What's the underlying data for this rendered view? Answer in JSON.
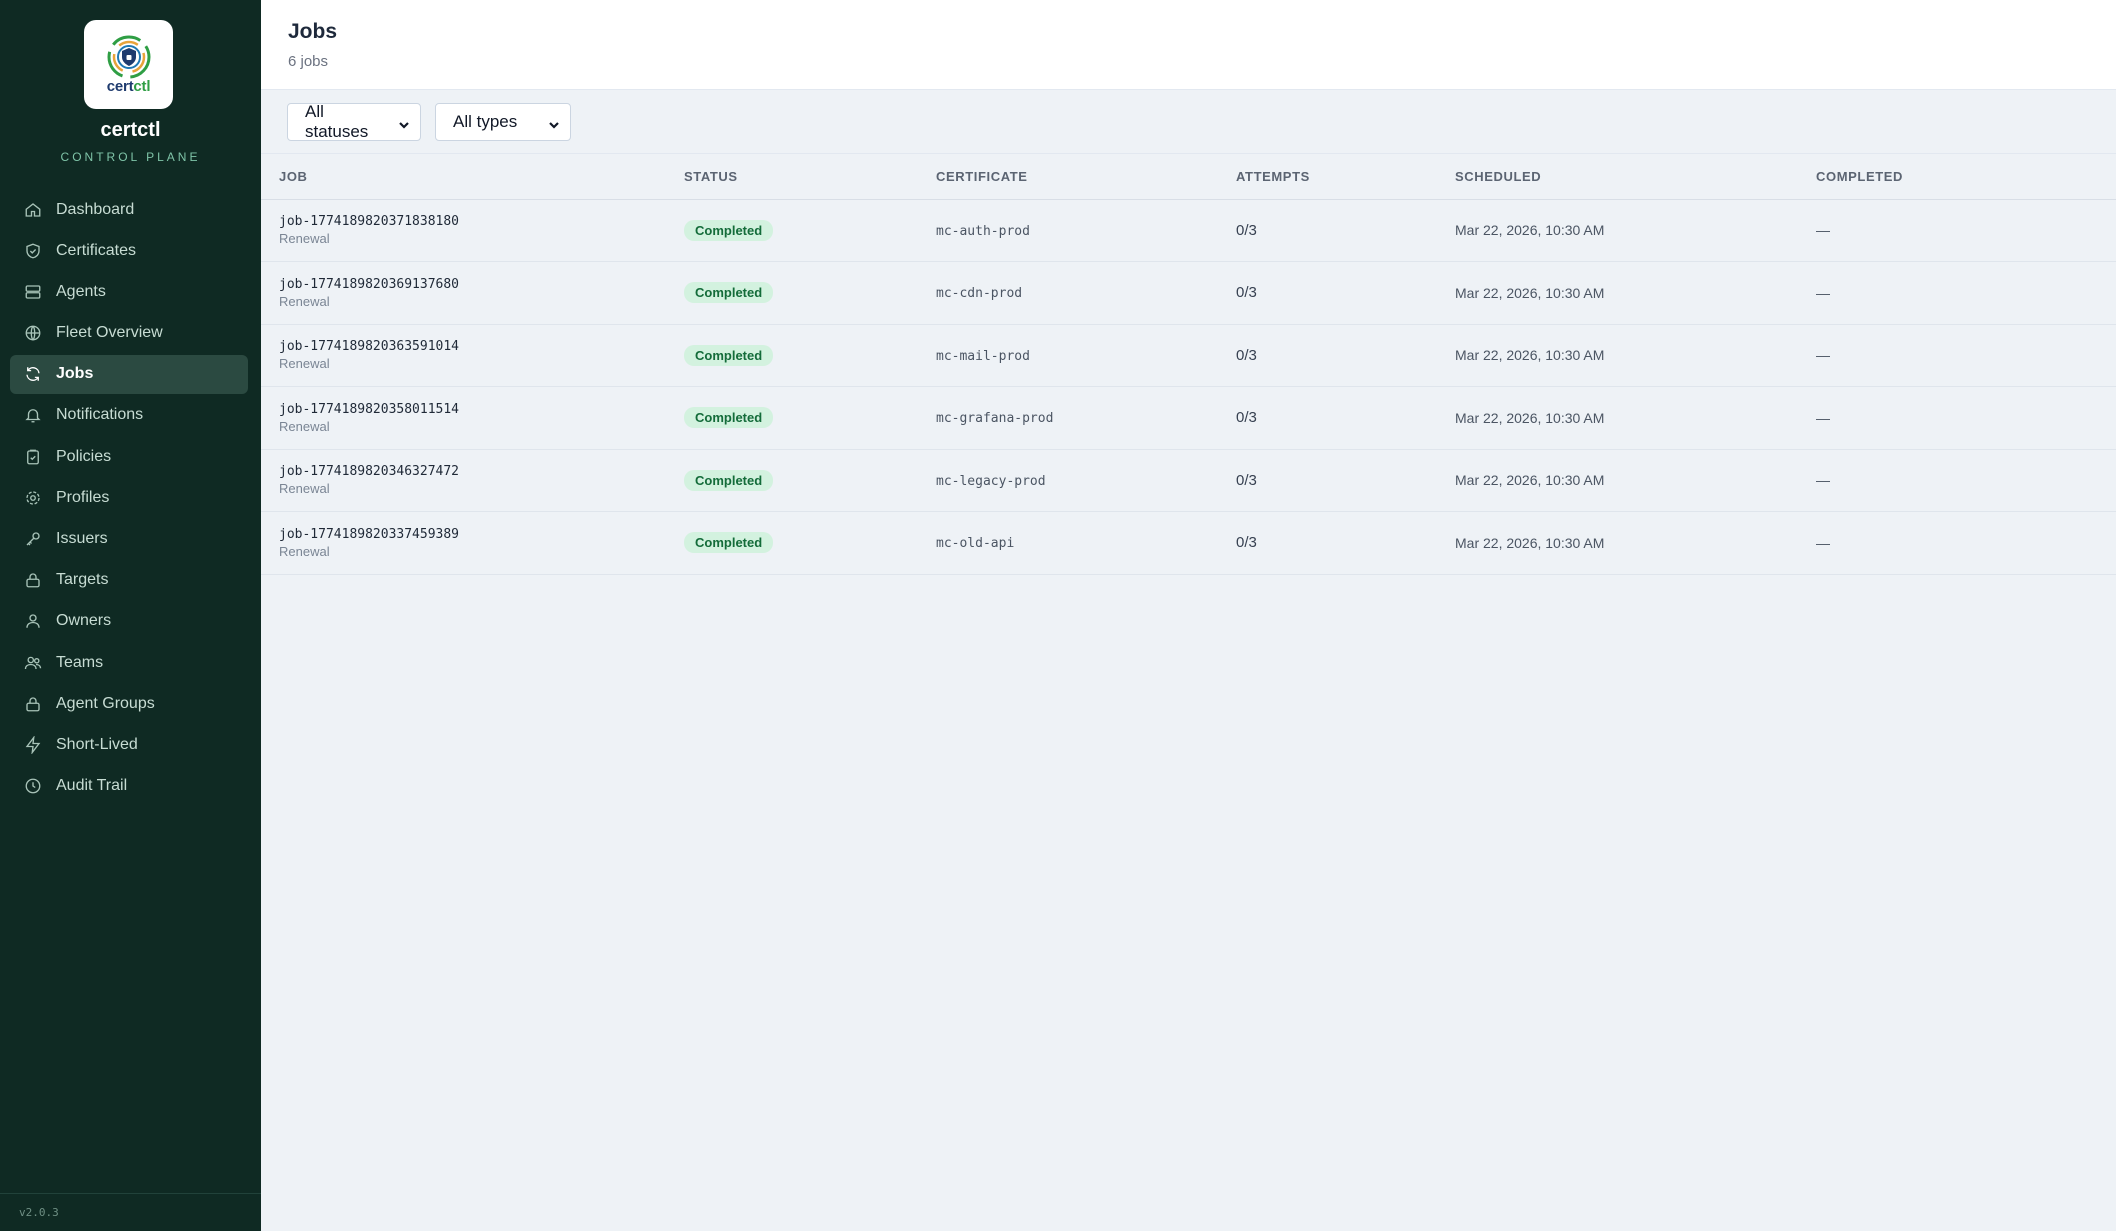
{
  "brand": {
    "logo_text_a": "cert",
    "logo_text_b": "ctl",
    "name": "certctl",
    "subtitle": "CONTROL PLANE",
    "version": "v2.0.3"
  },
  "sidebar": {
    "items": [
      {
        "label": "Dashboard",
        "icon": "home-icon",
        "active": false
      },
      {
        "label": "Certificates",
        "icon": "shield-check-icon",
        "active": false
      },
      {
        "label": "Agents",
        "icon": "server-icon",
        "active": false
      },
      {
        "label": "Fleet Overview",
        "icon": "globe-icon",
        "active": false
      },
      {
        "label": "Jobs",
        "icon": "refresh-icon",
        "active": true
      },
      {
        "label": "Notifications",
        "icon": "bell-icon",
        "active": false
      },
      {
        "label": "Policies",
        "icon": "clipboard-check-icon",
        "active": false
      },
      {
        "label": "Profiles",
        "icon": "gear-icon",
        "active": false
      },
      {
        "label": "Issuers",
        "icon": "key-icon",
        "active": false
      },
      {
        "label": "Targets",
        "icon": "lock-icon",
        "active": false
      },
      {
        "label": "Owners",
        "icon": "user-icon",
        "active": false
      },
      {
        "label": "Teams",
        "icon": "users-icon",
        "active": false
      },
      {
        "label": "Agent Groups",
        "icon": "lock-group-icon",
        "active": false
      },
      {
        "label": "Short-Lived",
        "icon": "lightning-icon",
        "active": false
      },
      {
        "label": "Audit Trail",
        "icon": "clock-icon",
        "active": false
      }
    ]
  },
  "header": {
    "title": "Jobs",
    "count": "6 jobs"
  },
  "filters": {
    "status": "All statuses",
    "type": "All types"
  },
  "table": {
    "columns": [
      "JOB",
      "STATUS",
      "CERTIFICATE",
      "ATTEMPTS",
      "SCHEDULED",
      "COMPLETED"
    ],
    "rows": [
      {
        "id": "job-1774189820371838180",
        "type": "Renewal",
        "status": "Completed",
        "certificate": "mc-auth-prod",
        "attempts": "0/3",
        "scheduled": "Mar 22, 2026, 10:30 AM",
        "completed": "—"
      },
      {
        "id": "job-1774189820369137680",
        "type": "Renewal",
        "status": "Completed",
        "certificate": "mc-cdn-prod",
        "attempts": "0/3",
        "scheduled": "Mar 22, 2026, 10:30 AM",
        "completed": "—"
      },
      {
        "id": "job-1774189820363591014",
        "type": "Renewal",
        "status": "Completed",
        "certificate": "mc-mail-prod",
        "attempts": "0/3",
        "scheduled": "Mar 22, 2026, 10:30 AM",
        "completed": "—"
      },
      {
        "id": "job-1774189820358011514",
        "type": "Renewal",
        "status": "Completed",
        "certificate": "mc-grafana-prod",
        "attempts": "0/3",
        "scheduled": "Mar 22, 2026, 10:30 AM",
        "completed": "—"
      },
      {
        "id": "job-1774189820346327472",
        "type": "Renewal",
        "status": "Completed",
        "certificate": "mc-legacy-prod",
        "attempts": "0/3",
        "scheduled": "Mar 22, 2026, 10:30 AM",
        "completed": "—"
      },
      {
        "id": "job-1774189820337459389",
        "type": "Renewal",
        "status": "Completed",
        "certificate": "mc-old-api",
        "attempts": "0/3",
        "scheduled": "Mar 22, 2026, 10:30 AM",
        "completed": "—"
      }
    ]
  },
  "colors": {
    "sidebar_bg": "#0f2a23",
    "active_item": "#2b4a41",
    "accent": "#7fc4a8",
    "badge_bg": "#d3f2df",
    "badge_text": "#146c3a",
    "main_bg": "#eef2f6"
  }
}
